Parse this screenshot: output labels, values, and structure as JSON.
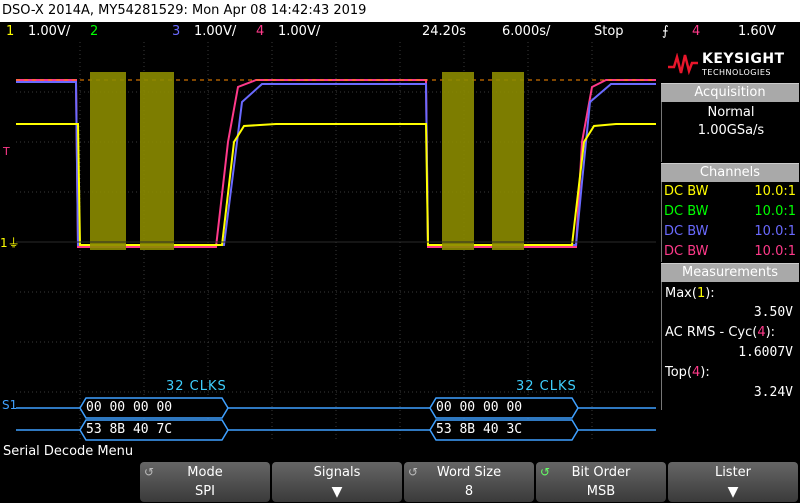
{
  "title": "DSO-X 2014A, MY54281529: Mon Apr 08 14:42:43 2019",
  "channels_bar": {
    "ch1_num": "1",
    "ch1_scale": "1.00V/",
    "ch2_num": "2",
    "ch3_num": "3",
    "ch3_scale": "1.00V/",
    "ch4_num": "4",
    "ch4_scale": "1.00V/",
    "delay": "24.20s",
    "timebase": "6.000s/",
    "run_state": "Stop",
    "trig_icon": "trigger-edge-icon",
    "trig_ch": "4",
    "trig_level": "1.60V"
  },
  "logo": {
    "brand": "KEYSIGHT",
    "sub": "TECHNOLOGIES"
  },
  "acquisition": {
    "header": "Acquisition",
    "mode": "Normal",
    "rate": "1.00GSa/s"
  },
  "channels": {
    "header": "Channels",
    "rows": [
      {
        "coupling": "DC BW",
        "probe": "10.0:1",
        "color": "#ffff00"
      },
      {
        "coupling": "DC BW",
        "probe": "10.0:1",
        "color": "#00ff00"
      },
      {
        "coupling": "DC BW",
        "probe": "10.0:1",
        "color": "#6a6aff"
      },
      {
        "coupling": "DC BW",
        "probe": "10.0:1",
        "color": "#ff3a8a"
      }
    ]
  },
  "measurements": {
    "header": "Measurements",
    "items": [
      {
        "label_prefix": "Max(",
        "ch": "1",
        "label_suffix": "):",
        "value": "3.50V",
        "ch_color": "#ffff00"
      },
      {
        "label_prefix": "AC RMS - Cyc(",
        "ch": "4",
        "label_suffix": "):",
        "value": "1.6007V",
        "ch_color": "#ff3a8a"
      },
      {
        "label_prefix": "Top(",
        "ch": "4",
        "label_suffix": "):",
        "value": "3.24V",
        "ch_color": "#ff3a8a"
      }
    ]
  },
  "decode": {
    "clks_label": "32 CLKS",
    "row_s1_marker": "S1",
    "frames": [
      {
        "mosi": "00 00 00 00",
        "miso": "53 8B 40 7C"
      },
      {
        "mosi": "00 00 00 00",
        "miso": "53 8B 40 3C"
      }
    ]
  },
  "menu_title": "Serial Decode Menu",
  "softkeys": [
    {
      "label": "Mode",
      "value": "SPI"
    },
    {
      "label": "Signals",
      "value": ""
    },
    {
      "label": "Word Size",
      "value": "8"
    },
    {
      "label": "Bit Order",
      "value": "MSB"
    },
    {
      "label": "Lister",
      "value": ""
    }
  ],
  "colors": {
    "ch1": "#ffff00",
    "ch2": "#00ff00",
    "ch3": "#6a6aff",
    "ch4": "#ff3a8a",
    "decode": "#3fa0ff",
    "accent": "#ff8c00"
  }
}
